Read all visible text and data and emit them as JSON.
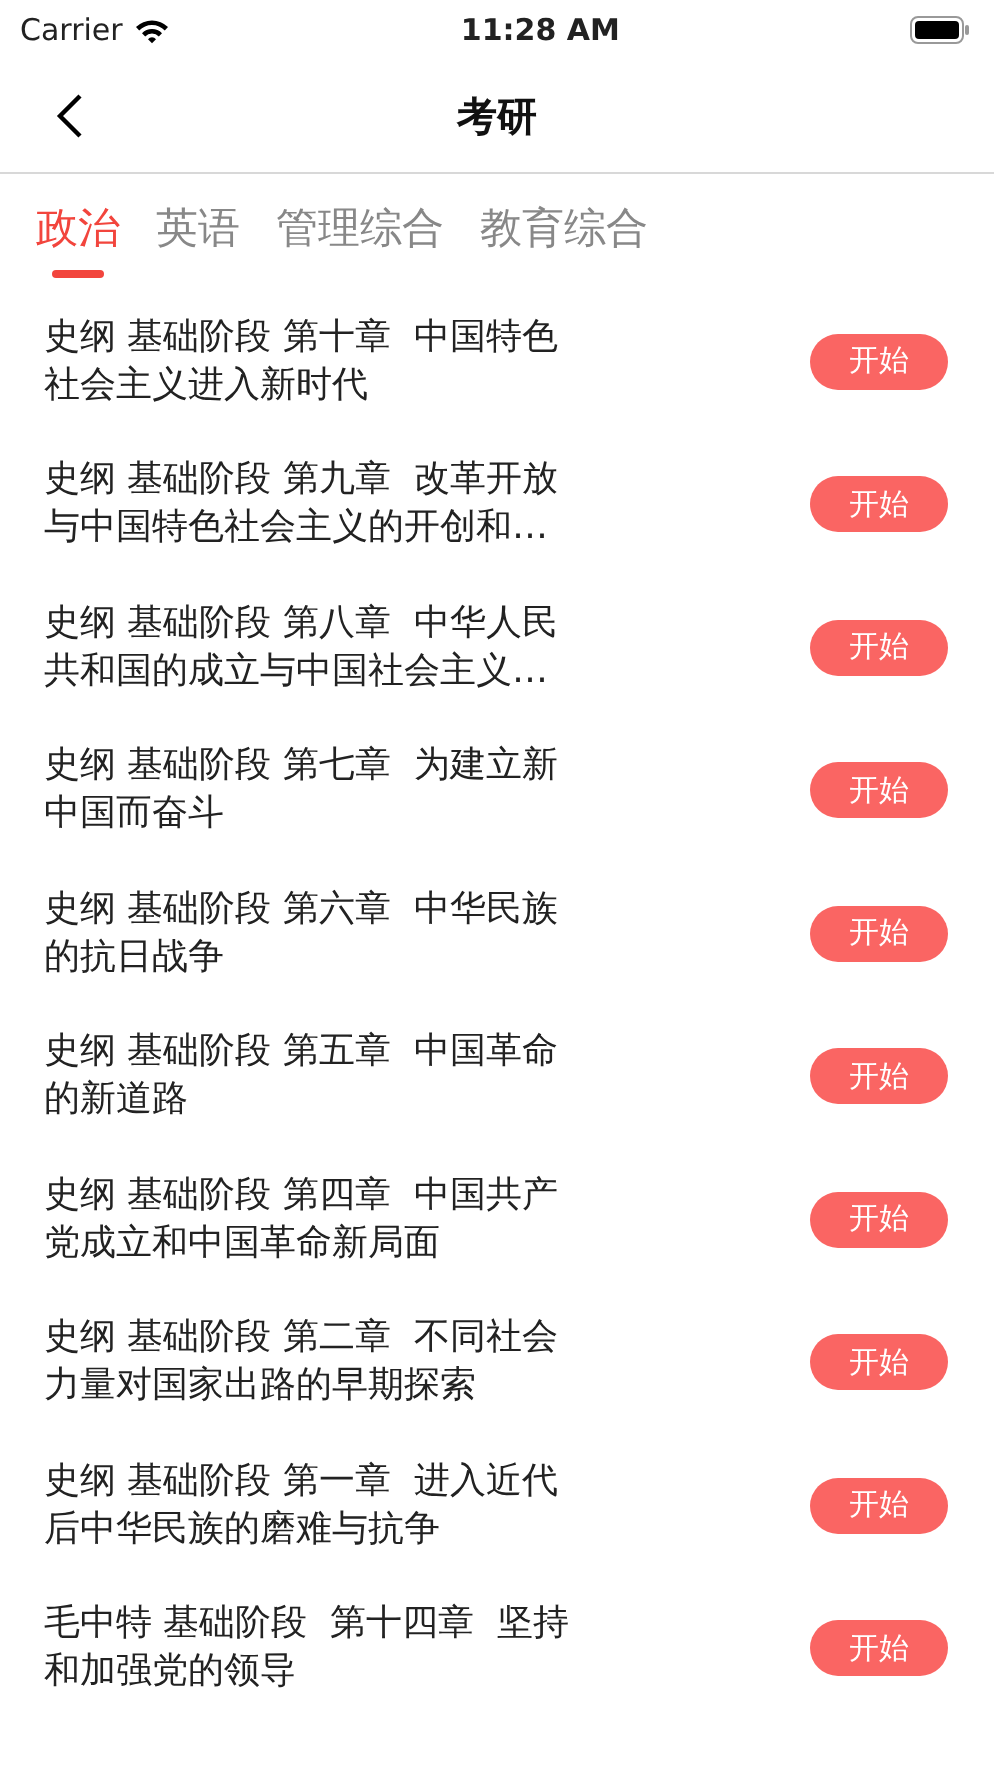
{
  "status_bar": {
    "carrier": "Carrier",
    "time": "11:28 AM"
  },
  "nav": {
    "title": "考研"
  },
  "tabs": [
    {
      "label": "政治",
      "selected": true
    },
    {
      "label": "英语",
      "selected": false
    },
    {
      "label": "管理综合",
      "selected": false
    },
    {
      "label": "教育综合",
      "selected": false
    }
  ],
  "items": [
    {
      "title": "史纲 基础阶段 第十章  中国特色社会主义进入新时代",
      "button": "开始"
    },
    {
      "title": "史纲 基础阶段 第九章  改革开放与中国特色社会主义的开创和…",
      "button": "开始"
    },
    {
      "title": "史纲 基础阶段 第八章  中华人民共和国的成立与中国社会主义…",
      "button": "开始"
    },
    {
      "title": "史纲 基础阶段 第七章  为建立新中国而奋斗",
      "button": "开始"
    },
    {
      "title": "史纲 基础阶段 第六章  中华民族的抗日战争",
      "button": "开始"
    },
    {
      "title": "史纲 基础阶段 第五章  中国革命的新道路",
      "button": "开始"
    },
    {
      "title": "史纲 基础阶段 第四章  中国共产党成立和中国革命新局面",
      "button": "开始"
    },
    {
      "title": "史纲 基础阶段 第二章  不同社会力量对国家出路的早期探索",
      "button": "开始"
    },
    {
      "title": "史纲 基础阶段 第一章  进入近代后中华民族的磨难与抗争",
      "button": "开始"
    },
    {
      "title": "毛中特 基础阶段  第十四章  坚持和加强党的领导",
      "button": "开始"
    }
  ]
}
